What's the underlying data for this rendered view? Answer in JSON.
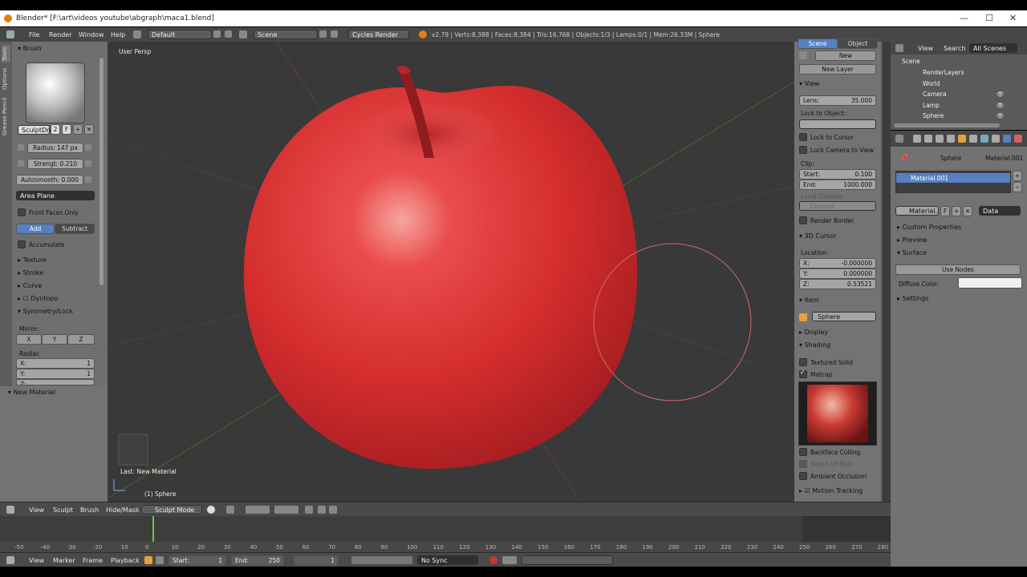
{
  "window": {
    "title": "Blender* [F:\\art\\videos youtube\\abgraph\\maca1.blend]",
    "minimize": "—",
    "maximize": "☐",
    "close": "✕"
  },
  "top_menu": {
    "items": [
      "File",
      "Render",
      "Window",
      "Help"
    ],
    "layout": "Default",
    "scene": "Scene",
    "engine": "Cycles Render",
    "stats": "v2.79 | Verts:8,388 | Faces:8,384 | Tris:16,768 | Objects:1/3 | Lamps:0/1 | Mem:26.33M | Sphere"
  },
  "tool_tabs": [
    "Tools",
    "Options",
    "Grease Pencil"
  ],
  "tools": {
    "brush_header": "Brush",
    "brush_name": "SculptDra",
    "brush_users": "2",
    "brush_fake": "F",
    "radius": "Radius: 147 px",
    "strength": "Strengt: 0.210",
    "autosmooth": "Autosmooth: 0.000",
    "area": "Area Plane",
    "front_faces": "Front Faces Only",
    "add": "Add",
    "subtract": "Subtract",
    "accumulate": "Accumulate",
    "texture": "Texture",
    "stroke": "Stroke",
    "curve": "Curve",
    "dyntopo": "Dyntopo",
    "symmetry": "Symmetry/Lock",
    "mirror": "Mirror:",
    "x": "X",
    "y": "Y",
    "z": "Z",
    "radial": "Radial:",
    "radial_x": "X:",
    "radial_x_val": "1",
    "radial_y": "Y:",
    "radial_y_val": "1",
    "radial_z": "Z:"
  },
  "last_op": {
    "header": "New Material",
    "label": "Last: New Material"
  },
  "viewport": {
    "persp": "User Persp",
    "object": "(1) Sphere"
  },
  "npanel": {
    "tab_scene": "Scene",
    "tab_object": "Object",
    "new": "New",
    "new_layer": "New Layer",
    "view": "View",
    "lens": "Lens:",
    "lens_val": "35.000",
    "lock_to_object": "Lock to Object:",
    "lock_to_cursor": "Lock to Cursor",
    "lock_camera": "Lock Camera to View",
    "clip": "Clip:",
    "start": "Start:",
    "start_val": "0.100",
    "end": "End:",
    "end_val": "1000.000",
    "local_camera": "Local Camera:",
    "camera": "Camera",
    "render_border": "Render Border",
    "cursor": "3D Cursor",
    "location": "Location:",
    "cx": "X:",
    "cx_val": "-0.000000",
    "cy": "Y:",
    "cy_val": "0.000000",
    "cz": "Z:",
    "cz_val": "0.53521",
    "item": "Item",
    "item_name": "Sphere",
    "display": "Display",
    "shading": "Shading",
    "textured_solid": "Textured Solid",
    "matcap": "Matcap",
    "backface": "Backface Culling",
    "dof": "Depth Of Field",
    "ao": "Ambient Occlusion",
    "motion_tracking": "Motion Tracking"
  },
  "outliner": {
    "view": "View",
    "search": "Search",
    "all_scenes": "All Scenes",
    "items": [
      "Scene",
      "RenderLayers",
      "World",
      "Camera",
      "Lamp",
      "Sphere"
    ]
  },
  "properties": {
    "breadcrumb_obj": "Sphere",
    "breadcrumb_mat": "Material.001",
    "slot": "Material.001",
    "material_field": "Material.",
    "fake": "F",
    "link": "Data",
    "custom_props": "Custom Properties",
    "preview": "Preview",
    "surface": "Surface",
    "use_nodes": "Use Nodes",
    "diffuse": "Diffuse Color:",
    "settings": "Settings"
  },
  "view_header": {
    "items": [
      "View",
      "Sculpt",
      "Brush",
      "Hide/Mask"
    ],
    "mode": "Sculpt Mode"
  },
  "timeline": {
    "ticks": [
      "-50",
      "-40",
      "-30",
      "-20",
      "-10",
      "0",
      "10",
      "20",
      "30",
      "40",
      "50",
      "60",
      "70",
      "80",
      "90",
      "100",
      "110",
      "120",
      "130",
      "140",
      "150",
      "160",
      "170",
      "180",
      "190",
      "200",
      "210",
      "220",
      "230",
      "240",
      "250",
      "260",
      "270",
      "280"
    ],
    "items": [
      "View",
      "Marker",
      "Frame",
      "Playback"
    ],
    "start": "Start:",
    "start_val": "1",
    "end": "End:",
    "end_val": "250",
    "current": "1",
    "sync": "No Sync"
  },
  "colors": {
    "apple_red": "#d42d2d",
    "panel": "#727272",
    "viewport": "#393939",
    "accent_blue": "#5680c2"
  }
}
